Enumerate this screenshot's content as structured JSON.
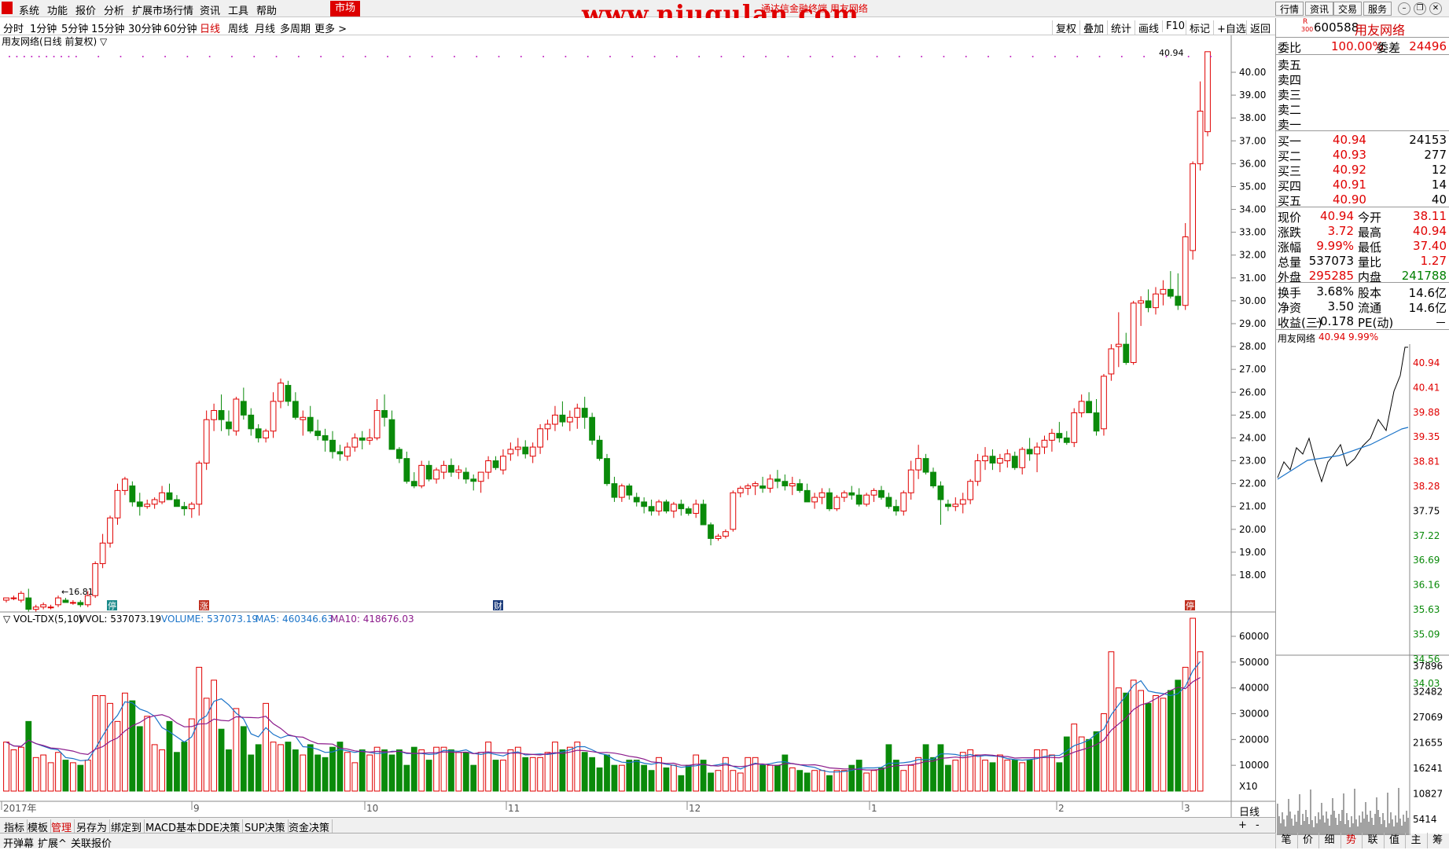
{
  "menu": {
    "items": [
      "系统",
      "功能",
      "报价",
      "分析",
      "扩展市场行情",
      "资讯",
      "工具",
      "帮助"
    ],
    "market": "市场"
  },
  "watermark": {
    "text": "www.niugulan.com",
    "sub": "通达信金融终端 用友网络"
  },
  "top_right_buttons": [
    "行情",
    "资讯",
    "交易",
    "服务"
  ],
  "periods": [
    "分时",
    "1分钟",
    "5分钟",
    "15分钟",
    "30分钟",
    "60分钟",
    "日线",
    "周线",
    "月线",
    "多周期",
    "更多 >"
  ],
  "active_period": "日线",
  "toolbar": [
    "复权",
    "叠加",
    "统计",
    "画线",
    "F10",
    "标记",
    "+自选",
    "返回"
  ],
  "chart_title": "用友网络(日线 前复权) ▽",
  "price_axis": [
    "40.00",
    "39.00",
    "38.00",
    "37.00",
    "36.00",
    "35.00",
    "34.00",
    "33.00",
    "32.00",
    "31.00",
    "30.00",
    "29.00",
    "28.00",
    "27.00",
    "26.00",
    "25.00",
    "24.00",
    "23.00",
    "22.00",
    "21.00",
    "20.00",
    "19.00",
    "18.00"
  ],
  "high_marker": "40.94",
  "low_marker": "←16.81",
  "event_badges": [
    "停",
    "涨",
    "财",
    "停"
  ],
  "vol_header": {
    "name": "▽ VOL-TDX(5,10)",
    "vvol": "VVOL: 537073.19",
    "volume": "VOLUME: 537073.19",
    "ma5": "MA5: 460346.63",
    "ma10": "MA10: 418676.03"
  },
  "vol_axis": [
    "60000",
    "50000",
    "40000",
    "30000",
    "20000",
    "10000",
    "X10"
  ],
  "date_axis": [
    "2017年",
    "9",
    "10",
    "11",
    "12",
    "1",
    "2",
    "3"
  ],
  "period_label": "日线",
  "bottom_tabs": [
    "指标",
    "模板",
    "管理",
    "另存为",
    "绑定到",
    "MACD基本",
    "DDE决策",
    "SUP决策",
    "资金决策"
  ],
  "status": [
    "开弹幕",
    "扩展^",
    "关联报价"
  ],
  "stock": {
    "code": "600588",
    "name": "用友网络",
    "badge_r": "R",
    "badge_300": "300"
  },
  "quote": {
    "weibi_label": "委比",
    "weibi": "100.00%",
    "weicha_label": "委差",
    "weicha": "24496",
    "sells": [
      {
        "label": "卖五"
      },
      {
        "label": "卖四"
      },
      {
        "label": "卖三"
      },
      {
        "label": "卖二"
      },
      {
        "label": "卖一"
      }
    ],
    "buys": [
      {
        "label": "买一",
        "price": "40.94",
        "vol": "24153"
      },
      {
        "label": "买二",
        "price": "40.93",
        "vol": "277"
      },
      {
        "label": "买三",
        "price": "40.92",
        "vol": "12"
      },
      {
        "label": "买四",
        "price": "40.91",
        "vol": "14"
      },
      {
        "label": "买五",
        "price": "40.90",
        "vol": "40"
      }
    ],
    "rows": [
      {
        "l1": "现价",
        "v1": "40.94",
        "c1": "red",
        "l2": "今开",
        "v2": "38.11",
        "c2": "red"
      },
      {
        "l1": "涨跌",
        "v1": "3.72",
        "c1": "red",
        "l2": "最高",
        "v2": "40.94",
        "c2": "red"
      },
      {
        "l1": "涨幅",
        "v1": "9.99%",
        "c1": "red",
        "l2": "最低",
        "v2": "37.40",
        "c2": "red"
      },
      {
        "l1": "总量",
        "v1": "537073",
        "c1": "black",
        "l2": "量比",
        "v2": "1.27",
        "c2": "red"
      },
      {
        "l1": "外盘",
        "v1": "295285",
        "c1": "red",
        "l2": "内盘",
        "v2": "241788",
        "c2": "green"
      }
    ],
    "rows2": [
      {
        "l1": "换手",
        "v1": "3.68%",
        "l2": "股本",
        "v2": "14.6亿"
      },
      {
        "l1": "净资",
        "v1": "3.50",
        "l2": "流通",
        "v2": "14.6亿"
      },
      {
        "l1": "收益(三)",
        "v1": "-0.178",
        "l2": "PE(动)",
        "v2": "－"
      }
    ]
  },
  "mini": {
    "name": "用友网络",
    "price": "40.94",
    "pct": "9.99%",
    "price_axis": [
      "40.94",
      "40.41",
      "39.88",
      "39.35",
      "38.81",
      "38.28",
      "37.75",
      "37.22",
      "36.69",
      "36.16",
      "35.63",
      "35.09",
      "34.56",
      "34.03"
    ],
    "vol_axis": [
      "37896",
      "32482",
      "27069",
      "21655",
      "16241",
      "10827",
      "5414"
    ]
  },
  "right_tabs": [
    "笔",
    "价",
    "细",
    "势",
    "联",
    "值",
    "主",
    "筹"
  ],
  "active_right_tab": "势",
  "colors": {
    "up": "#e00000",
    "down": "#0a8a0a",
    "ma5": "#1a73c8",
    "ma10": "#8b1a8b",
    "accent": "#d00000"
  },
  "chart_data": {
    "type": "candlestick",
    "title": "用友网络(日线 前复权)",
    "ylim": [
      16.8,
      41.0
    ],
    "candles": [
      [
        16.9,
        17.0,
        16.8,
        17.0
      ],
      [
        17.0,
        17.1,
        16.9,
        17.0
      ],
      [
        16.9,
        17.3,
        16.8,
        17.2
      ],
      [
        17.0,
        17.4,
        16.4,
        16.5
      ],
      [
        16.5,
        16.7,
        16.4,
        16.6
      ],
      [
        16.6,
        16.8,
        16.5,
        16.7
      ],
      [
        16.6,
        16.7,
        16.5,
        16.6
      ],
      [
        16.7,
        17.1,
        16.6,
        17.0
      ],
      [
        16.9,
        17.0,
        16.8,
        16.8
      ],
      [
        16.8,
        16.9,
        16.7,
        16.8
      ],
      [
        16.8,
        16.9,
        16.6,
        16.7
      ],
      [
        16.7,
        17.3,
        16.6,
        17.1
      ],
      [
        17.1,
        18.6,
        17.0,
        18.5
      ],
      [
        18.5,
        19.8,
        18.3,
        19.4
      ],
      [
        19.4,
        20.6,
        19.2,
        20.5
      ],
      [
        20.5,
        22.0,
        20.2,
        21.7
      ],
      [
        21.7,
        22.3,
        21.5,
        22.2
      ],
      [
        21.9,
        22.1,
        21.0,
        21.2
      ],
      [
        21.2,
        21.6,
        20.6,
        21.0
      ],
      [
        21.0,
        21.3,
        20.9,
        21.1
      ],
      [
        21.1,
        21.4,
        20.9,
        21.3
      ],
      [
        21.2,
        21.9,
        21.1,
        21.6
      ],
      [
        21.6,
        22.0,
        21.3,
        21.3
      ],
      [
        21.3,
        21.5,
        21.0,
        21.0
      ],
      [
        21.0,
        21.2,
        20.6,
        20.9
      ],
      [
        20.9,
        21.2,
        20.5,
        21.1
      ],
      [
        21.1,
        23.0,
        20.6,
        22.9
      ],
      [
        22.9,
        25.2,
        22.6,
        24.8
      ],
      [
        24.8,
        25.5,
        24.3,
        25.2
      ],
      [
        25.2,
        25.9,
        24.3,
        24.8
      ],
      [
        24.7,
        25.2,
        24.1,
        24.4
      ],
      [
        24.3,
        25.8,
        24.1,
        25.7
      ],
      [
        25.6,
        26.2,
        24.8,
        25.0
      ],
      [
        25.0,
        25.3,
        24.1,
        24.4
      ],
      [
        24.4,
        24.6,
        23.8,
        24.0
      ],
      [
        24.0,
        24.4,
        23.8,
        24.3
      ],
      [
        24.3,
        26.0,
        24.0,
        25.6
      ],
      [
        25.6,
        26.6,
        25.3,
        26.4
      ],
      [
        26.3,
        26.5,
        25.4,
        25.6
      ],
      [
        25.6,
        26.0,
        24.8,
        24.9
      ],
      [
        24.8,
        25.2,
        24.1,
        24.9
      ],
      [
        24.9,
        25.4,
        24.2,
        24.3
      ],
      [
        24.3,
        24.8,
        23.9,
        24.1
      ],
      [
        24.1,
        24.4,
        23.4,
        23.9
      ],
      [
        23.9,
        24.3,
        23.1,
        23.4
      ],
      [
        23.4,
        23.7,
        23.0,
        23.3
      ],
      [
        23.2,
        23.8,
        23.0,
        23.6
      ],
      [
        23.6,
        24.2,
        23.4,
        24.0
      ],
      [
        24.0,
        24.3,
        23.5,
        23.9
      ],
      [
        23.9,
        24.4,
        23.7,
        24.0
      ],
      [
        24.0,
        25.7,
        23.9,
        25.2
      ],
      [
        25.2,
        25.9,
        24.5,
        24.9
      ],
      [
        24.8,
        25.2,
        23.6,
        23.5
      ],
      [
        23.5,
        23.6,
        22.9,
        23.1
      ],
      [
        23.1,
        23.4,
        22.0,
        22.1
      ],
      [
        22.1,
        22.5,
        21.8,
        21.9
      ],
      [
        21.9,
        23.0,
        21.8,
        22.8
      ],
      [
        22.8,
        23.0,
        22.1,
        22.2
      ],
      [
        22.2,
        22.7,
        22.0,
        22.6
      ],
      [
        22.5,
        23.0,
        22.2,
        22.8
      ],
      [
        22.8,
        23.1,
        22.3,
        22.5
      ],
      [
        22.5,
        22.8,
        22.2,
        22.6
      ],
      [
        22.5,
        22.7,
        22.0,
        22.2
      ],
      [
        22.2,
        22.4,
        21.7,
        22.1
      ],
      [
        22.1,
        22.4,
        21.6,
        22.5
      ],
      [
        22.5,
        23.2,
        22.2,
        23.0
      ],
      [
        23.0,
        23.2,
        22.6,
        22.7
      ],
      [
        22.6,
        23.5,
        22.4,
        23.2
      ],
      [
        23.3,
        23.8,
        23.0,
        23.5
      ],
      [
        23.5,
        24.0,
        23.2,
        23.6
      ],
      [
        23.6,
        23.9,
        23.1,
        23.3
      ],
      [
        23.2,
        23.8,
        22.9,
        23.6
      ],
      [
        23.6,
        24.6,
        23.3,
        24.4
      ],
      [
        24.4,
        24.8,
        23.9,
        24.6
      ],
      [
        24.6,
        25.4,
        24.3,
        25.0
      ],
      [
        25.0,
        25.6,
        24.5,
        24.7
      ],
      [
        24.7,
        25.2,
        24.3,
        24.9
      ],
      [
        24.9,
        25.5,
        24.4,
        25.3
      ],
      [
        25.3,
        25.8,
        24.4,
        24.9
      ],
      [
        24.9,
        25.1,
        23.7,
        23.9
      ],
      [
        23.9,
        24.1,
        23.0,
        23.1
      ],
      [
        23.1,
        23.3,
        21.9,
        22.0
      ],
      [
        22.0,
        22.3,
        21.2,
        21.4
      ],
      [
        21.4,
        22.0,
        21.2,
        21.9
      ],
      [
        21.9,
        22.0,
        21.3,
        21.5
      ],
      [
        21.4,
        21.6,
        21.0,
        21.2
      ],
      [
        21.2,
        21.4,
        20.7,
        21.0
      ],
      [
        21.0,
        21.3,
        20.6,
        20.8
      ],
      [
        20.8,
        21.3,
        20.6,
        21.2
      ],
      [
        21.2,
        21.3,
        20.7,
        20.8
      ],
      [
        20.8,
        21.2,
        20.5,
        21.1
      ],
      [
        21.1,
        21.3,
        20.6,
        20.9
      ],
      [
        20.9,
        21.0,
        20.6,
        20.7
      ],
      [
        20.7,
        21.3,
        20.5,
        21.1
      ],
      [
        21.1,
        21.3,
        20.2,
        20.2
      ],
      [
        20.2,
        20.3,
        19.3,
        19.6
      ],
      [
        19.6,
        19.8,
        19.5,
        19.7
      ],
      [
        19.7,
        20.0,
        19.6,
        19.9
      ],
      [
        20.0,
        21.7,
        19.9,
        21.6
      ],
      [
        21.6,
        21.9,
        21.4,
        21.8
      ],
      [
        21.8,
        22.0,
        21.5,
        21.9
      ],
      [
        21.9,
        22.1,
        21.5,
        22.0
      ],
      [
        21.9,
        22.3,
        21.6,
        21.8
      ],
      [
        21.8,
        22.4,
        21.6,
        22.2
      ],
      [
        22.2,
        22.6,
        21.8,
        22.1
      ],
      [
        22.1,
        22.4,
        21.7,
        21.9
      ],
      [
        21.9,
        22.3,
        21.5,
        22.0
      ],
      [
        22.0,
        22.2,
        21.6,
        21.7
      ],
      [
        21.7,
        22.0,
        21.2,
        21.2
      ],
      [
        21.2,
        21.6,
        20.9,
        21.4
      ],
      [
        21.4,
        21.8,
        21.1,
        21.6
      ],
      [
        21.6,
        21.8,
        20.8,
        20.9
      ],
      [
        20.9,
        21.5,
        20.8,
        21.4
      ],
      [
        21.4,
        21.7,
        21.2,
        21.6
      ],
      [
        21.6,
        21.9,
        21.3,
        21.5
      ],
      [
        21.5,
        21.8,
        21.0,
        21.1
      ],
      [
        21.1,
        21.6,
        21.0,
        21.5
      ],
      [
        21.5,
        21.8,
        21.2,
        21.7
      ],
      [
        21.7,
        21.9,
        21.3,
        21.4
      ],
      [
        21.4,
        21.6,
        20.9,
        21.0
      ],
      [
        21.0,
        21.3,
        20.6,
        20.8
      ],
      [
        20.8,
        21.7,
        20.6,
        21.6
      ],
      [
        21.6,
        23.0,
        21.3,
        22.6
      ],
      [
        22.6,
        23.7,
        22.2,
        23.1
      ],
      [
        23.1,
        23.3,
        22.4,
        22.5
      ],
      [
        22.5,
        22.7,
        21.8,
        21.9
      ],
      [
        21.9,
        22.1,
        20.2,
        21.3
      ],
      [
        21.1,
        21.3,
        20.8,
        21.0
      ],
      [
        21.0,
        21.4,
        20.8,
        21.1
      ],
      [
        21.1,
        21.6,
        20.7,
        21.3
      ],
      [
        21.3,
        22.2,
        21.1,
        22.1
      ],
      [
        22.1,
        23.3,
        21.9,
        23.0
      ],
      [
        23.0,
        23.6,
        22.6,
        23.2
      ],
      [
        23.2,
        23.5,
        22.6,
        22.9
      ],
      [
        22.9,
        23.3,
        22.5,
        23.1
      ],
      [
        23.0,
        23.5,
        22.7,
        23.3
      ],
      [
        23.2,
        23.4,
        22.6,
        22.7
      ],
      [
        22.7,
        23.6,
        22.4,
        23.5
      ],
      [
        23.5,
        24.0,
        23.0,
        23.3
      ],
      [
        23.3,
        23.8,
        22.5,
        23.6
      ],
      [
        23.6,
        24.1,
        23.3,
        23.9
      ],
      [
        23.9,
        24.4,
        23.4,
        24.2
      ],
      [
        24.2,
        24.7,
        23.8,
        24.0
      ],
      [
        24.0,
        24.3,
        23.7,
        23.8
      ],
      [
        23.8,
        25.3,
        23.6,
        25.1
      ],
      [
        25.1,
        25.9,
        24.9,
        25.6
      ],
      [
        25.6,
        26.0,
        25.1,
        25.1
      ],
      [
        25.1,
        25.7,
        24.1,
        24.3
      ],
      [
        24.4,
        26.8,
        24.1,
        26.7
      ],
      [
        26.8,
        28.1,
        26.5,
        27.9
      ],
      [
        28.0,
        29.5,
        27.1,
        28.1
      ],
      [
        28.1,
        28.6,
        27.2,
        27.3
      ],
      [
        27.3,
        30.0,
        27.2,
        29.9
      ],
      [
        29.9,
        30.2,
        28.9,
        30.0
      ],
      [
        30.0,
        30.5,
        29.5,
        29.7
      ],
      [
        29.7,
        30.6,
        29.4,
        30.3
      ],
      [
        30.3,
        30.9,
        29.8,
        30.5
      ],
      [
        30.5,
        31.3,
        30.1,
        30.2
      ],
      [
        30.2,
        31.2,
        29.6,
        29.8
      ],
      [
        29.8,
        33.4,
        29.6,
        32.8
      ],
      [
        32.2,
        36.1,
        31.8,
        36.0
      ],
      [
        36.0,
        39.6,
        35.7,
        38.3
      ],
      [
        37.4,
        40.9,
        37.2,
        40.9
      ]
    ],
    "volume": [
      1.9,
      1.6,
      1.7,
      2.7,
      1.3,
      1.4,
      1.1,
      1.5,
      1.2,
      1.1,
      1.0,
      1.2,
      3.7,
      3.7,
      3.4,
      2.7,
      3.8,
      3.5,
      2.5,
      2.9,
      1.8,
      1.6,
      2.7,
      1.5,
      1.9,
      2.8,
      4.8,
      3.6,
      4.3,
      2.4,
      1.6,
      3.2,
      2.5,
      1.4,
      1.8,
      3.4,
      1.9,
      1.8,
      1.9,
      1.6,
      1.4,
      1.8,
      1.4,
      1.3,
      1.7,
      1.9,
      1.5,
      1.1,
      1.6,
      1.4,
      1.7,
      1.6,
      1.4,
      1.6,
      1.0,
      1.7,
      1.6,
      1.2,
      1.7,
      1.7,
      1.6,
      1.5,
      1.5,
      1.0,
      1.5,
      1.9,
      1.2,
      1.2,
      1.6,
      1.7,
      1.3,
      1.3,
      1.3,
      1.5,
      1.9,
      1.6,
      1.7,
      1.9,
      1.5,
      1.3,
      0.9,
      1.4,
      1.0,
      1.0,
      1.2,
      1.2,
      1.0,
      0.8,
      1.3,
      0.9,
      1.0,
      0.6,
      1.0,
      1.4,
      1.2,
      0.7,
      0.8,
      1.3,
      0.8,
      0.7,
      1.3,
      1.3,
      1.0,
      1.0,
      1.0,
      1.4,
      0.9,
      0.8,
      0.7,
      0.8,
      0.8,
      0.6,
      0.8,
      0.8,
      1.0,
      1.2,
      0.7,
      0.8,
      0.9,
      1.8,
      1.2,
      0.8,
      1.0,
      1.3,
      1.8,
      1.3,
      1.8,
      1.0,
      1.2,
      1.5,
      1.6,
      1.4,
      1.2,
      1.1,
      1.4,
      1.2,
      1.2,
      1.1,
      1.2,
      1.6,
      1.6,
      1.4,
      1.1,
      2.1,
      2.6,
      2.1,
      2.0,
      2.3,
      3.0,
      5.4,
      4.0,
      3.8,
      4.3,
      3.9,
      3.4,
      3.7,
      3.6,
      3.9,
      4.3,
      4.8,
      6.7,
      5.4
    ]
  }
}
